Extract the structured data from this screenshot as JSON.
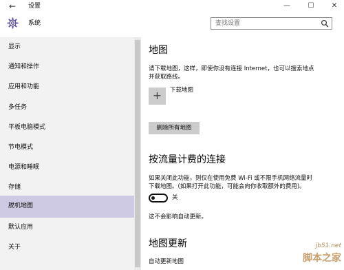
{
  "window": {
    "title": "设置",
    "controls": {
      "minimize": "—",
      "maximize": "☐",
      "close": "✕"
    },
    "back_glyph": "←"
  },
  "header": {
    "app_name": "系统",
    "icon": "gear-icon",
    "search": {
      "placeholder": "查找设置",
      "icon": "search-icon"
    }
  },
  "sidebar": {
    "items": [
      {
        "label": "显示",
        "selected": false
      },
      {
        "label": "通知和操作",
        "selected": false
      },
      {
        "label": "应用和功能",
        "selected": false
      },
      {
        "label": "多任务",
        "selected": false
      },
      {
        "label": "平板电脑模式",
        "selected": false
      },
      {
        "label": "节电模式",
        "selected": false
      },
      {
        "label": "电源和睡眠",
        "selected": false
      },
      {
        "label": "存储",
        "selected": false
      },
      {
        "label": "脱机地图",
        "selected": true
      },
      {
        "label": "默认应用",
        "selected": false
      },
      {
        "label": "关于",
        "selected": false
      }
    ],
    "selected_color": "#cfcae3"
  },
  "main": {
    "maps": {
      "title": "地图",
      "description_line1": "请下载地图，这样，即使你没有连接 Internet，也可以搜索地点",
      "description_line2": "并获取路线。",
      "add_icon": "plus-icon",
      "download_label": "下载地图",
      "delete_all_button": "删除所有地图"
    },
    "metered": {
      "title": "按流量计费的连接",
      "description_line1": "如果关闭此功能，则仅在使用免费 Wi-Fi 或不限手机网络流量时",
      "description_line2": "下载地图。(如果打开此功能，可能会向你收取额外的费用)。",
      "toggle_state": "关",
      "note": "这不会影响自动更新。"
    },
    "updates": {
      "title": "地图更新",
      "auto_update_label": "自动更新地图"
    }
  },
  "watermark": {
    "url": "jb51.net",
    "brand": "脚本之家"
  }
}
